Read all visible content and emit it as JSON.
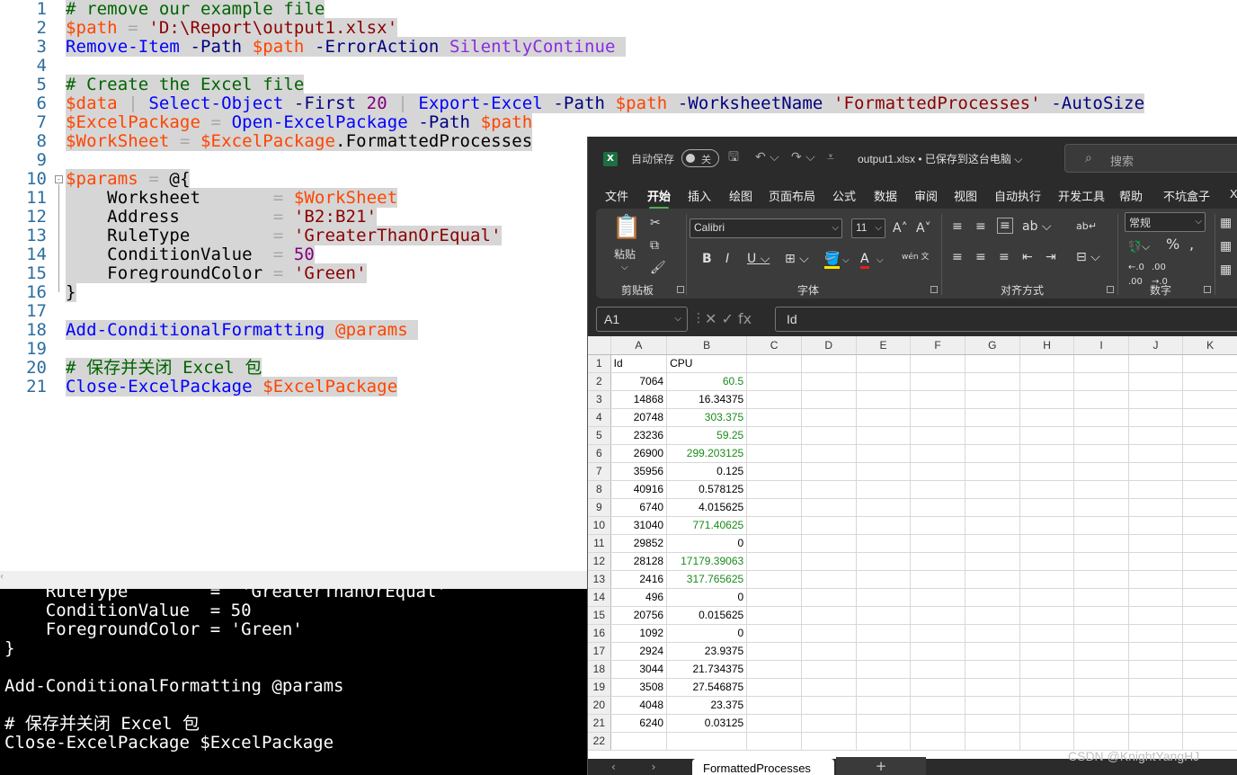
{
  "editor": {
    "line_numbers": [
      "1",
      "2",
      "3",
      "4",
      "5",
      "6",
      "7",
      "8",
      "9",
      "10",
      "11",
      "12",
      "13",
      "14",
      "15",
      "16",
      "17",
      "18",
      "19",
      "20",
      "21"
    ],
    "fold_marker": "-",
    "lines": [
      [
        [
          "c-com",
          "# remove our example file"
        ]
      ],
      [
        [
          "c-var",
          "$path"
        ],
        [
          "c-op",
          " = "
        ],
        [
          "c-str",
          "'D:\\Report\\output1.xlsx'"
        ]
      ],
      [
        [
          "c-cmd",
          "Remove-Item"
        ],
        [
          "c-par",
          " -Path "
        ],
        [
          "c-var",
          "$path"
        ],
        [
          "c-par",
          " -ErrorAction "
        ],
        [
          "c-enum",
          "SilentlyContinue"
        ],
        [
          "c-txt",
          " "
        ]
      ],
      [],
      [
        [
          "c-com",
          "# Create the Excel file"
        ]
      ],
      [
        [
          "c-var",
          "$data"
        ],
        [
          "c-op",
          " | "
        ],
        [
          "c-cmd",
          "Select-Object"
        ],
        [
          "c-par",
          " -First "
        ],
        [
          "c-num",
          "20"
        ],
        [
          "c-op",
          " | "
        ],
        [
          "c-cmd",
          "Export-Excel"
        ],
        [
          "c-par",
          " -Path "
        ],
        [
          "c-var",
          "$path"
        ],
        [
          "c-par",
          " -WorksheetName "
        ],
        [
          "c-str",
          "'FormattedProcesses'"
        ],
        [
          "c-par",
          " -AutoSize"
        ]
      ],
      [
        [
          "c-var",
          "$ExcelPackage"
        ],
        [
          "c-op",
          " = "
        ],
        [
          "c-cmd",
          "Open-ExcelPackage"
        ],
        [
          "c-par",
          " -Path "
        ],
        [
          "c-var",
          "$path"
        ]
      ],
      [
        [
          "c-var",
          "$WorkSheet"
        ],
        [
          "c-op",
          " = "
        ],
        [
          "c-var",
          "$ExcelPackage"
        ],
        [
          "c-txt",
          ".FormattedProcesses"
        ]
      ],
      [],
      [
        [
          "c-var",
          "$params"
        ],
        [
          "c-op",
          " = "
        ],
        [
          "c-txt",
          "@{"
        ]
      ],
      [
        [
          "c-txt",
          "    Worksheet       "
        ],
        [
          "c-op",
          "= "
        ],
        [
          "c-var",
          "$WorkSheet"
        ]
      ],
      [
        [
          "c-txt",
          "    Address         "
        ],
        [
          "c-op",
          "= "
        ],
        [
          "c-str",
          "'B2:B21'"
        ]
      ],
      [
        [
          "c-txt",
          "    RuleType        "
        ],
        [
          "c-op",
          "= "
        ],
        [
          "c-str",
          "'GreaterThanOrEqual'"
        ]
      ],
      [
        [
          "c-txt",
          "    ConditionValue  "
        ],
        [
          "c-op",
          "= "
        ],
        [
          "c-num",
          "50"
        ]
      ],
      [
        [
          "c-txt",
          "    ForegroundColor "
        ],
        [
          "c-op",
          "= "
        ],
        [
          "c-str",
          "'Green'"
        ]
      ],
      [
        [
          "c-txt",
          "}"
        ]
      ],
      [],
      [
        [
          "c-cmd",
          "Add-ConditionalFormatting"
        ],
        [
          "c-txt",
          " "
        ],
        [
          "c-var",
          "@params"
        ],
        [
          "c-txt",
          " "
        ]
      ],
      [],
      [
        [
          "c-com",
          "# 保存并关闭 Excel 包"
        ]
      ],
      [
        [
          "c-cmd",
          "Close-ExcelPackage"
        ],
        [
          "c-txt",
          " "
        ],
        [
          "c-var",
          "$ExcelPackage"
        ]
      ]
    ]
  },
  "console": {
    "lines": [
      "    RuleType        =  'GreaterThanOrEqual'",
      "    ConditionValue  = 50",
      "    ForegroundColor = 'Green'",
      "}",
      "",
      "Add-ConditionalFormatting @params",
      "",
      "# 保存并关闭 Excel 包",
      "Close-ExcelPackage $ExcelPackage",
      "",
      "    ........."
    ]
  },
  "excel": {
    "logo": "X",
    "autosave_label": "自动保存",
    "autosave_state": "关",
    "filename": "output1.xlsx • 已保存到这台电脑 ⌵",
    "search_placeholder": "搜索",
    "search_icon": "search-icon",
    "menus": [
      "文件",
      "开始",
      "插入",
      "绘图",
      "页面布局",
      "公式",
      "数据",
      "审阅",
      "视图",
      "自动执行",
      "开发工具",
      "帮助",
      "不坑盒子",
      "X"
    ],
    "active_menu": "开始",
    "ribbon": {
      "clipboard_label": "剪贴板",
      "paste_label": "粘贴",
      "font_label": "字体",
      "font_name": "Calibri",
      "font_size": "11",
      "align_label": "对齐方式",
      "number_label": "数字",
      "number_format": "常规"
    },
    "name_box": "A1",
    "formula_value": "Id",
    "fx_symbols": "✕ ✓ fx",
    "columns": [
      "A",
      "B",
      "C",
      "D",
      "E",
      "F",
      "G",
      "H",
      "I",
      "J",
      "K"
    ],
    "rows": [
      {
        "n": "1",
        "a": "Id",
        "b": "CPU",
        "green": false
      },
      {
        "n": "2",
        "a": "7064",
        "b": "60.5",
        "green": true
      },
      {
        "n": "3",
        "a": "14868",
        "b": "16.34375",
        "green": false
      },
      {
        "n": "4",
        "a": "20748",
        "b": "303.375",
        "green": true
      },
      {
        "n": "5",
        "a": "23236",
        "b": "59.25",
        "green": true
      },
      {
        "n": "6",
        "a": "26900",
        "b": "299.203125",
        "green": true
      },
      {
        "n": "7",
        "a": "35956",
        "b": "0.125",
        "green": false
      },
      {
        "n": "8",
        "a": "40916",
        "b": "0.578125",
        "green": false
      },
      {
        "n": "9",
        "a": "6740",
        "b": "4.015625",
        "green": false
      },
      {
        "n": "10",
        "a": "31040",
        "b": "771.40625",
        "green": true
      },
      {
        "n": "11",
        "a": "29852",
        "b": "0",
        "green": false
      },
      {
        "n": "12",
        "a": "28128",
        "b": "17179.39063",
        "green": true
      },
      {
        "n": "13",
        "a": "2416",
        "b": "317.765625",
        "green": true
      },
      {
        "n": "14",
        "a": "496",
        "b": "0",
        "green": false
      },
      {
        "n": "15",
        "a": "20756",
        "b": "0.015625",
        "green": false
      },
      {
        "n": "16",
        "a": "1092",
        "b": "0",
        "green": false
      },
      {
        "n": "17",
        "a": "2924",
        "b": "23.9375",
        "green": false
      },
      {
        "n": "18",
        "a": "3044",
        "b": "21.734375",
        "green": false
      },
      {
        "n": "19",
        "a": "3508",
        "b": "27.546875",
        "green": false
      },
      {
        "n": "20",
        "a": "4048",
        "b": "23.375",
        "green": false
      },
      {
        "n": "21",
        "a": "6240",
        "b": "0.03125",
        "green": false
      },
      {
        "n": "22",
        "a": "",
        "b": "",
        "green": false
      }
    ],
    "sheet_tab": "FormattedProcesses",
    "sheet_nav": "‹ ›",
    "add_sheet": "+",
    "green_color": "#1a8a1a"
  },
  "watermark": "CSDN @KnightYangHJ"
}
